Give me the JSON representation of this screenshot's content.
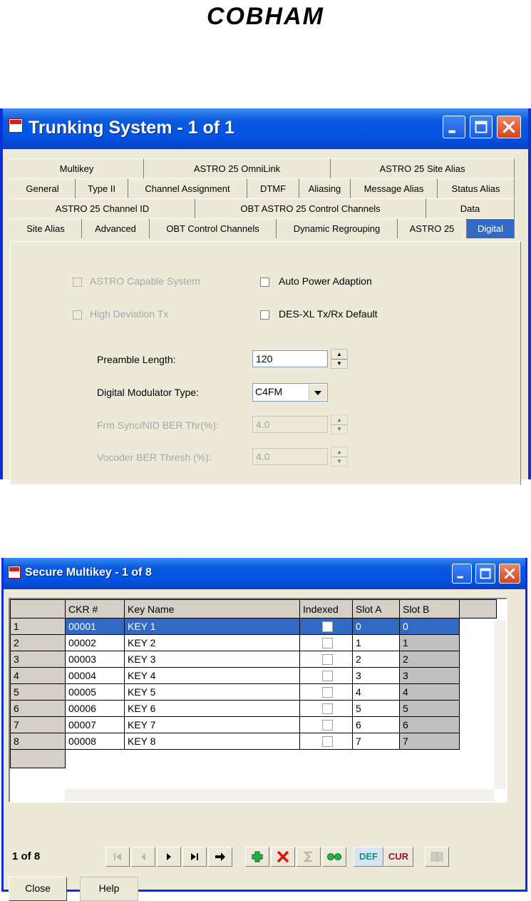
{
  "logo": {
    "text": "COBHAM"
  },
  "trunking_window": {
    "title": "Trunking System - 1 of 1",
    "tab_rows": [
      [
        "Multikey",
        "ASTRO 25 OmniLink",
        "ASTRO 25 Site Alias"
      ],
      [
        "General",
        "Type II",
        "Channel Assignment",
        "DTMF",
        "Aliasing",
        "Message Alias",
        "Status Alias"
      ],
      [
        "ASTRO 25 Channel ID",
        "OBT ASTRO 25 Control Channels",
        "Data"
      ],
      [
        "Site Alias",
        "Advanced",
        "OBT Control Channels",
        "Dynamic Regrouping",
        "ASTRO 25",
        "Digital"
      ]
    ],
    "active_tab": "Digital",
    "checkboxes": {
      "astro_capable": {
        "label": "ASTRO Capable System",
        "checked": false,
        "enabled": false
      },
      "auto_power": {
        "label": "Auto Power Adaption",
        "checked": false,
        "enabled": true
      },
      "high_deviation": {
        "label": "High Deviation Tx",
        "checked": false,
        "enabled": false
      },
      "des_xl": {
        "label": "DES-XL Tx/Rx Default",
        "checked": false,
        "enabled": true
      }
    },
    "fields": {
      "preamble": {
        "label": "Preamble Length:",
        "value": "120"
      },
      "modulator": {
        "label": "Digital Modulator Type:",
        "value": "C4FM"
      },
      "frm_sync": {
        "label": "Frm Sync/NID BER Thr(%):",
        "value": "4.0"
      },
      "vocoder": {
        "label": "Vocoder BER Thresh (%):",
        "value": "4.0"
      }
    }
  },
  "multikey_window": {
    "title": "Secure Multikey - 1 of 8",
    "columns": [
      "CKR #",
      "Key Name",
      "Indexed",
      "Slot A",
      "Slot B"
    ],
    "rows": [
      {
        "num": "1",
        "ckr": "00001",
        "name": "KEY 1",
        "slot_a": "0",
        "slot_b": "0"
      },
      {
        "num": "2",
        "ckr": "00002",
        "name": "KEY 2",
        "slot_a": "1",
        "slot_b": "1"
      },
      {
        "num": "3",
        "ckr": "00003",
        "name": "KEY 3",
        "slot_a": "2",
        "slot_b": "2"
      },
      {
        "num": "4",
        "ckr": "00004",
        "name": "KEY 4",
        "slot_a": "3",
        "slot_b": "3"
      },
      {
        "num": "5",
        "ckr": "00005",
        "name": "KEY 5",
        "slot_a": "4",
        "slot_b": "4"
      },
      {
        "num": "6",
        "ckr": "00006",
        "name": "KEY 6",
        "slot_a": "5",
        "slot_b": "5"
      },
      {
        "num": "7",
        "ckr": "00007",
        "name": "KEY 7",
        "slot_a": "6",
        "slot_b": "6"
      },
      {
        "num": "8",
        "ckr": "00008",
        "name": "KEY 8",
        "slot_a": "7",
        "slot_b": "7"
      }
    ],
    "record_counter": "1 of 8",
    "toolbar": {
      "def_label": "DEF",
      "cur_label": "CUR"
    },
    "buttons": {
      "close": "Close",
      "help": "Help"
    }
  }
}
